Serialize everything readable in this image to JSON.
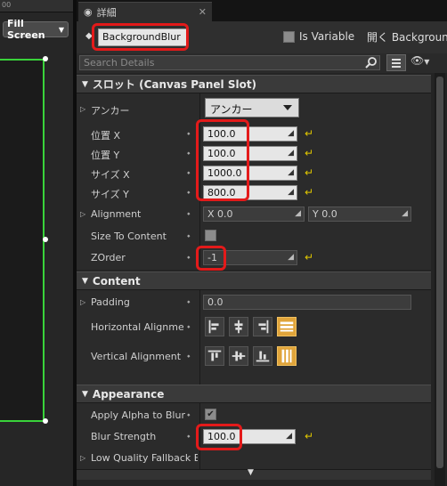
{
  "canvas": {
    "ruler_text": "00",
    "screen_size": "Fill Screen"
  },
  "tab": {
    "title": "詳細",
    "icon": "details-icon"
  },
  "header": {
    "name": "BackgroundBlur",
    "is_variable_label": "Is Variable",
    "is_variable_checked": false,
    "open_link": "開く Backgroun"
  },
  "search": {
    "placeholder": "Search Details"
  },
  "slot": {
    "title": "スロット (Canvas Panel Slot)",
    "anchor_label": "アンカー",
    "anchor_value": "アンカー",
    "pos_x_label": "位置 X",
    "pos_x": "100.0",
    "pos_y_label": "位置 Y",
    "pos_y": "100.0",
    "size_x_label": "サイズ X",
    "size_x": "1000.0",
    "size_y_label": "サイズ Y",
    "size_y": "800.0",
    "alignment_label": "Alignment",
    "align_x": "X  0.0",
    "align_y": "Y  0.0",
    "size_to_content_label": "Size To Content",
    "size_to_content": false,
    "zorder_label": "ZOrder",
    "zorder": "-1"
  },
  "content": {
    "title": "Content",
    "padding_label": "Padding",
    "padding": "0.0",
    "h_align_label": "Horizontal Alignmen",
    "v_align_label": "Vertical Alignment"
  },
  "appearance": {
    "title": "Appearance",
    "apply_alpha_label": "Apply Alpha to Blur",
    "apply_alpha": true,
    "blur_strength_label": "Blur Strength",
    "blur_strength": "100.0",
    "low_quality_label": "Low Quality Fallback Bru"
  },
  "colors": {
    "highlight": "#e31a1a",
    "selection_green": "#39d33a",
    "active_align": "#e0a43a",
    "reset_arrow": "#e0c700"
  }
}
